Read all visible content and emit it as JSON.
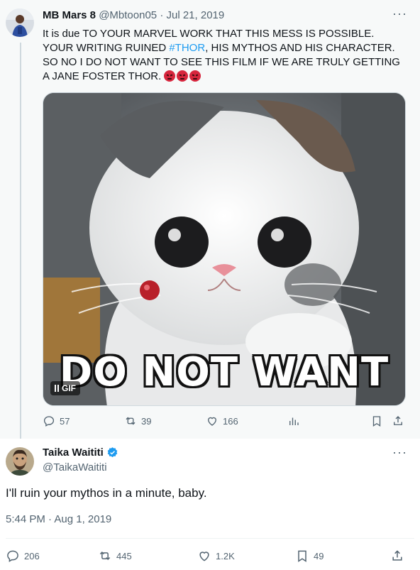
{
  "reply": {
    "author_name": "MB Mars 8",
    "author_handle": "@Mbtoon05",
    "separator": "·",
    "date": "Jul 21, 2019",
    "more": "···",
    "text_before": "It is due TO YOUR MARVEL WORK THAT THIS MESS IS POSSIBLE. YOUR WRITING RUINED ",
    "hashtag": "#THOR",
    "text_after": ", HIS MYTHOS AND HIS CHARACTER. SO NO I DO NOT WANT TO SEE THIS FILM IF WE ARE TRULY GETTING A JANE FOSTER THOR.",
    "media": {
      "caption": "DO NOT WANT",
      "badge": "GIF"
    },
    "actions": {
      "replies": "57",
      "retweets": "39",
      "likes": "166"
    }
  },
  "main": {
    "author_name": "Taika Waititi",
    "author_handle": "@TaikaWaititi",
    "more": "···",
    "text": "I'll ruin your mythos in a minute, baby.",
    "timestamp": "5:44 PM · Aug 1, 2019",
    "actions": {
      "replies": "206",
      "retweets": "445",
      "likes": "1.2K",
      "bookmarks": "49"
    }
  },
  "colors": {
    "accent": "#1d9bf0",
    "muted": "#536471",
    "text": "#0f1419",
    "reply_bg": "#f7f9f9"
  },
  "icons": [
    "reply-icon",
    "retweet-icon",
    "like-icon",
    "views-icon",
    "bookmark-icon",
    "share-icon",
    "verified-badge-icon",
    "angry-face-icon",
    "pause-icon"
  ]
}
